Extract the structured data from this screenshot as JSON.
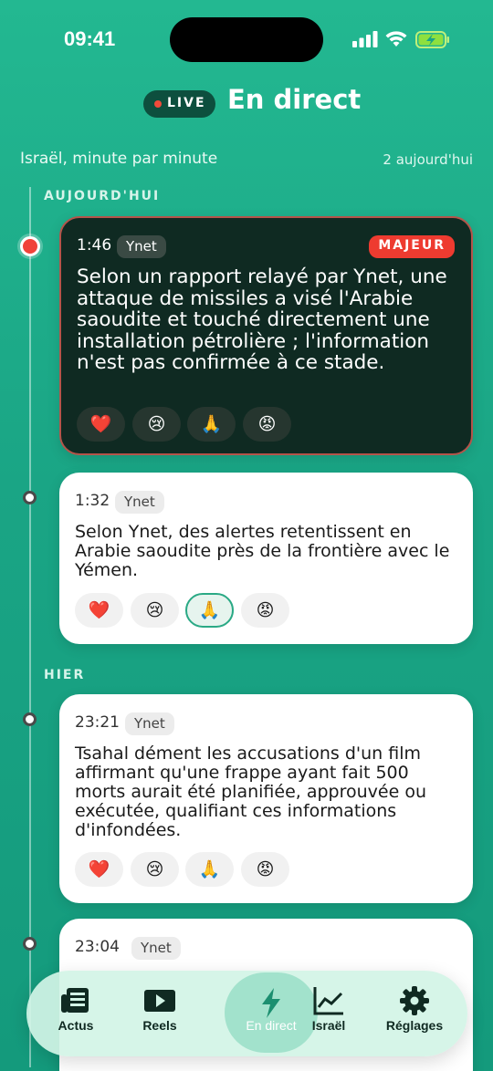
{
  "status_bar": {
    "time": "09:41"
  },
  "header": {
    "live_label": "LIVE",
    "title": "En direct"
  },
  "subheader": {
    "subtitle": "Israël, minute par minute",
    "count": "2 aujourd'hui"
  },
  "sections": {
    "today": "AUJOURD'HUI",
    "yesterday": "HIER"
  },
  "cards": [
    {
      "time": "1:46",
      "source": "Ynet",
      "badge": "MAJEUR",
      "text": "Selon un rapport relayé par Ynet, une attaque de missiles a visé l'Arabie saoudite et touché directement une installation pétrolière ; l'information n'est pas confirmée à ce stade."
    },
    {
      "time": "1:32",
      "source": "Ynet",
      "text": "Selon Ynet, des alertes retentissent en Arabie saoudite près de la frontière avec le Yémen."
    },
    {
      "time": "23:21",
      "source": "Ynet",
      "text": "Tsahal dément les accusations d'un film affirmant qu'une frappe ayant fait 500 morts aurait été planifiée, approuvée ou exécutée, qualifiant ces informations d'infondées."
    },
    {
      "time": "23:04",
      "source": "Ynet"
    }
  ],
  "reactions": [
    "heart-emoji",
    "crying-emoji",
    "praying-hands-emoji",
    "angry-emoji"
  ],
  "tabbar": {
    "tabs": [
      {
        "label": "Actus",
        "icon": "newspaper-icon"
      },
      {
        "label": "Reels",
        "icon": "play-icon"
      },
      {
        "label": "En direct",
        "icon": "lightning-icon"
      },
      {
        "label": "Israël",
        "icon": "chart-icon"
      },
      {
        "label": "Réglages",
        "icon": "gear-icon"
      }
    ],
    "active": "En direct"
  },
  "colors": {
    "accent": "#1aa585",
    "major_badge": "#ee3b30",
    "major_card": "#0f2a22"
  }
}
